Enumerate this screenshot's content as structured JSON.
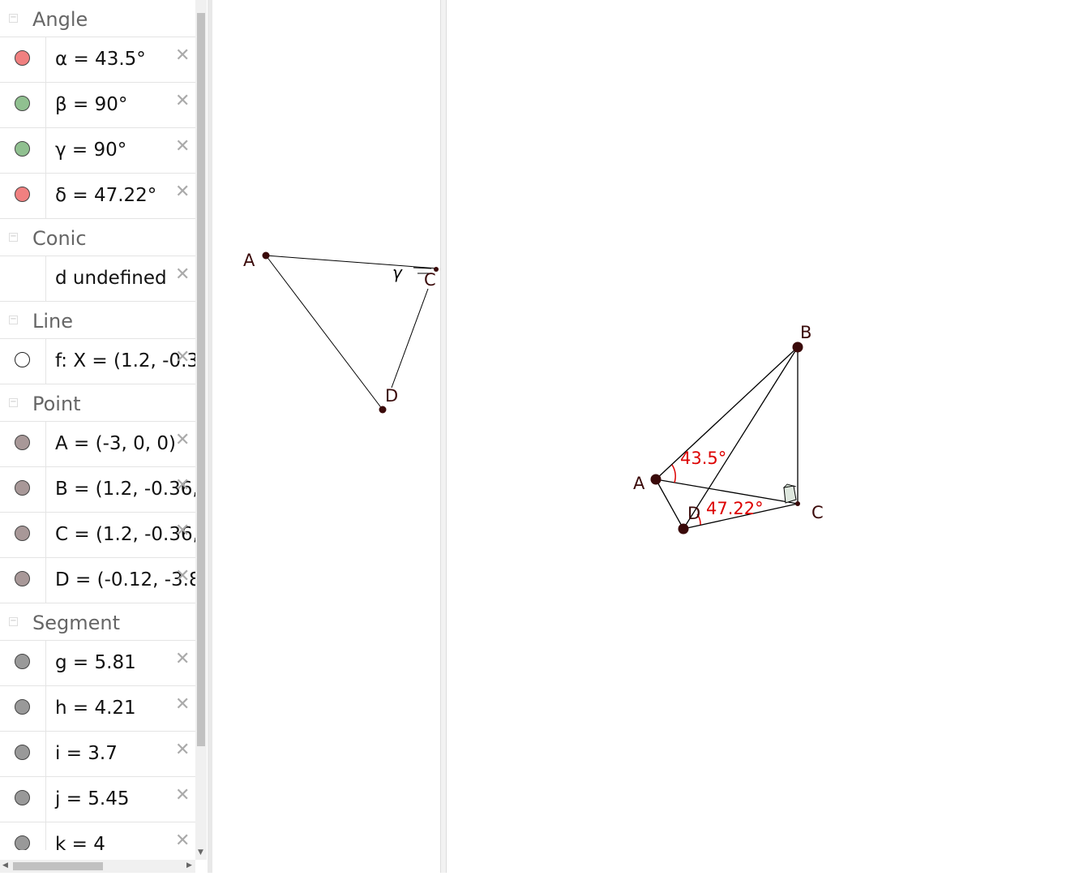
{
  "algebra": {
    "groups": [
      {
        "title": "Angle",
        "items": [
          {
            "text": "α = 43.5°",
            "color": "#f08080"
          },
          {
            "text": "β = 90°",
            "color": "#90c090"
          },
          {
            "text": "γ = 90°",
            "color": "#90c090"
          },
          {
            "text": "δ = 47.22°",
            "color": "#f08080"
          }
        ]
      },
      {
        "title": "Conic",
        "items": [
          {
            "text": "d undefined",
            "color": ""
          }
        ]
      },
      {
        "title": "Line",
        "items": [
          {
            "text": "f: X = (1.2, -0.3",
            "color": "#ffffff"
          }
        ]
      },
      {
        "title": "Point",
        "items": [
          {
            "text": "A = (-3, 0, 0)",
            "color": "#a89898"
          },
          {
            "text": "B = (1.2, -0.36,",
            "color": "#a89898"
          },
          {
            "text": "C = (1.2, -0.36,",
            "color": "#a89898"
          },
          {
            "text": "D = (-0.12, -3.8",
            "color": "#a89898"
          }
        ]
      },
      {
        "title": "Segment",
        "items": [
          {
            "text": "g = 5.81",
            "color": "#999999"
          },
          {
            "text": "h = 4.21",
            "color": "#999999"
          },
          {
            "text": "i = 3.7",
            "color": "#999999"
          },
          {
            "text": "j = 5.45",
            "color": "#999999"
          },
          {
            "text": "k = 4",
            "color": "#999999"
          }
        ]
      }
    ],
    "collapse_glyph": "−",
    "delete_glyph": "✕"
  },
  "view2d": {
    "label_A": "A",
    "label_C": "C",
    "label_D": "D",
    "label_gamma": "γ"
  },
  "view3d": {
    "label_A": "A",
    "label_B": "B",
    "label_C": "C",
    "label_D": "D",
    "angle_alpha": "43.5°",
    "angle_delta": "47.22°",
    "angle_color": "#dd0000"
  }
}
